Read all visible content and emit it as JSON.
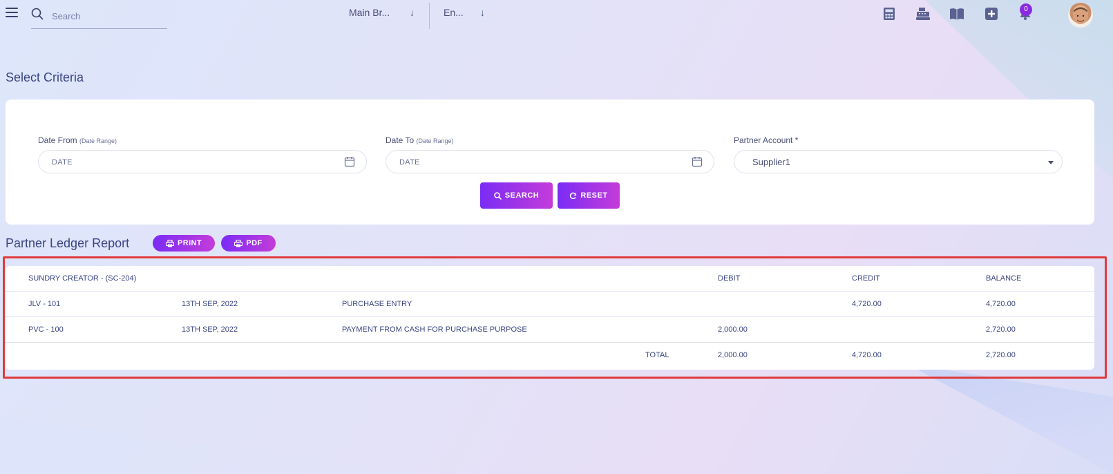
{
  "topbar": {
    "search_placeholder": "Search",
    "branch_select": "Main Br...",
    "language_select": "En...",
    "notification_count": "0",
    "icons": [
      "calculator-icon",
      "cash-register-icon",
      "book-icon",
      "plus-square-icon",
      "bell-icon"
    ]
  },
  "criteria": {
    "title": "Select Criteria",
    "date_from": {
      "label": "Date From",
      "hint": "(Date Range)",
      "placeholder": "DATE"
    },
    "date_to": {
      "label": "Date To",
      "hint": "(Date Range)",
      "placeholder": "DATE"
    },
    "partner": {
      "label": "Partner Account *",
      "value": "Supplier1"
    },
    "search_label": "SEARCH",
    "reset_label": "RESET"
  },
  "report": {
    "title": "Partner Ledger Report",
    "print_label": "PRINT",
    "pdf_label": "PDF",
    "header": {
      "account": "SUNDRY CREATOR - (SC-204)",
      "debit": "DEBIT",
      "credit": "CREDIT",
      "balance": "BALANCE"
    },
    "rows": [
      {
        "voucher": "JLV - 101",
        "date": "13TH SEP, 2022",
        "description": "PURCHASE ENTRY",
        "debit": "",
        "credit": "4,720.00",
        "balance": "4,720.00"
      },
      {
        "voucher": "PVC - 100",
        "date": "13TH SEP, 2022",
        "description": "PAYMENT FROM CASH FOR PURCHASE PURPOSE",
        "debit": "2,000.00",
        "credit": "",
        "balance": "2,720.00"
      }
    ],
    "total": {
      "label": "TOTAL",
      "debit": "2,000.00",
      "credit": "4,720.00",
      "balance": "2,720.00"
    }
  },
  "colors": {
    "accent_start": "#7a2cf5",
    "accent_end": "#c43cd9",
    "highlight_border": "#e03a3a",
    "text": "#3b4580"
  }
}
